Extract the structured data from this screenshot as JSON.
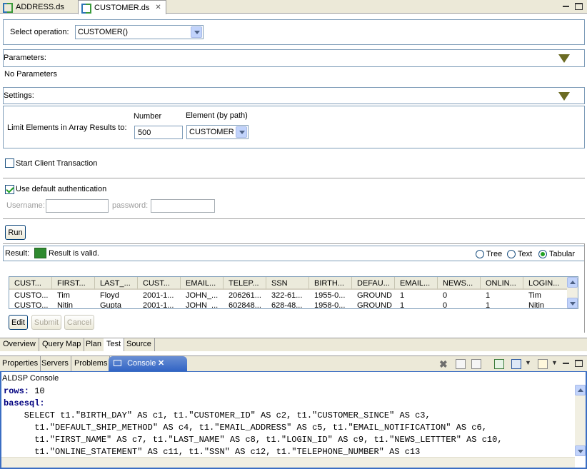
{
  "editor_tabs": [
    {
      "label": "ADDRESS.ds",
      "active": false
    },
    {
      "label": "CUSTOMER.ds",
      "active": true
    }
  ],
  "operation": {
    "label": "Select operation:",
    "value": "CUSTOMER()"
  },
  "parameters": {
    "header": "Parameters:",
    "body": "No Parameters"
  },
  "settings": {
    "header": "Settings:",
    "limit_label": "Limit Elements in Array Results to:",
    "number_label": "Number",
    "number_value": "500",
    "element_label": "Element (by path)",
    "element_value": "CUSTOMER"
  },
  "transaction": {
    "label": "Start Client Transaction",
    "checked": false
  },
  "auth": {
    "label": "Use default authentication",
    "checked": true,
    "username_label": "Username:",
    "password_label": "password:"
  },
  "run_label": "Run",
  "result": {
    "label": "Result:",
    "status": "Result is valid.",
    "views": [
      "Tree",
      "Text",
      "Tabular"
    ],
    "selected_view": "Tabular"
  },
  "table": {
    "columns": [
      "CUST...",
      "FIRST...",
      "LAST_...",
      "CUST...",
      "EMAIL...",
      "TELEP...",
      "SSN",
      "BIRTH...",
      "DEFAU...",
      "EMAIL...",
      "NEWS...",
      "ONLIN...",
      "LOGIN..."
    ],
    "rows": [
      [
        "CUSTO...",
        "Tim",
        "Floyd",
        "2001-1...",
        "JOHN_...",
        "206261...",
        "322-61...",
        "1955-0...",
        "GROUND",
        "1",
        "0",
        "1",
        "Tim"
      ],
      [
        "CUSTO...",
        "Nitin",
        "Gupta",
        "2001-1...",
        "JOHN_...",
        "602848...",
        "628-48...",
        "1958-0...",
        "GROUND",
        "1",
        "0",
        "1",
        "Nitin"
      ]
    ]
  },
  "actions": {
    "edit": "Edit",
    "submit": "Submit",
    "cancel": "Cancel"
  },
  "page_tabs": [
    "Overview",
    "Query Map",
    "Plan",
    "Test",
    "Source"
  ],
  "active_page_tab": "Test",
  "view_tabs": [
    "Properties",
    "Servers",
    "Problems"
  ],
  "console": {
    "tab_label": "Console",
    "title": "ALDSP Console",
    "rows_key": "rows:",
    "rows_value": "10",
    "basesql_key": "basesql:",
    "sql_lines": [
      "    SELECT t1.\"BIRTH_DAY\" AS c1, t1.\"CUSTOMER_ID\" AS c2, t1.\"CUSTOMER_SINCE\" AS c3,",
      "      t1.\"DEFAULT_SHIP_METHOD\" AS c4, t1.\"EMAIL_ADDRESS\" AS c5, t1.\"EMAIL_NOTIFICATION\" AS c6,",
      "      t1.\"FIRST_NAME\" AS c7, t1.\"LAST_NAME\" AS c8, t1.\"LOGIN_ID\" AS c9, t1.\"NEWS_LETTTER\" AS c10,",
      "      t1.\"ONLINE_STATEMENT\" AS c11, t1.\"SSN\" AS c12, t1.\"TELEPHONE_NUMBER\" AS c13"
    ]
  }
}
